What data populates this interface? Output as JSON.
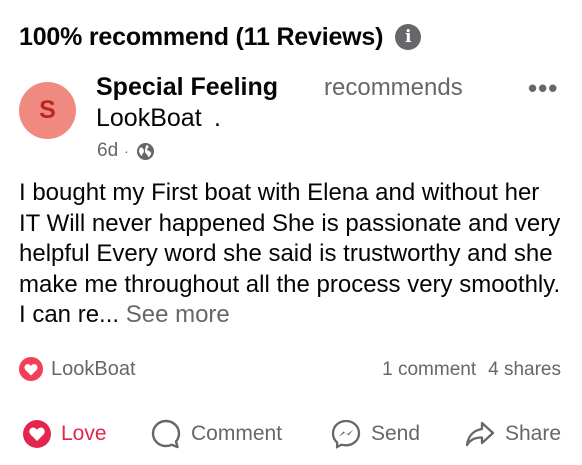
{
  "header": {
    "title": "100% recommend (11 Reviews)",
    "info_icon": "info-icon"
  },
  "review": {
    "avatar_letter": "S",
    "author_name": "Special Feeling",
    "author_page": "LookBoat",
    "page_dot": ".",
    "verb": "recommends",
    "time": "6d",
    "separator": "·",
    "privacy_icon": "globe-icon",
    "body": "I bought my First boat with Elena and without her IT Will never happened  She is passionate and very helpful  Every word she said is trustworthy and she make me throughout all the process very smoothly. I can re...",
    "see_more": "See more"
  },
  "reactions": {
    "reactor": "LookBoat",
    "comments": "1 comment",
    "shares": "4 shares"
  },
  "actions": {
    "love": "Love",
    "comment": "Comment",
    "send": "Send",
    "share": "Share"
  },
  "colors": {
    "love_red": "#e4264e",
    "muted_gray": "#65676b",
    "avatar_bg": "#f08a80",
    "avatar_fg": "#b8281f"
  }
}
